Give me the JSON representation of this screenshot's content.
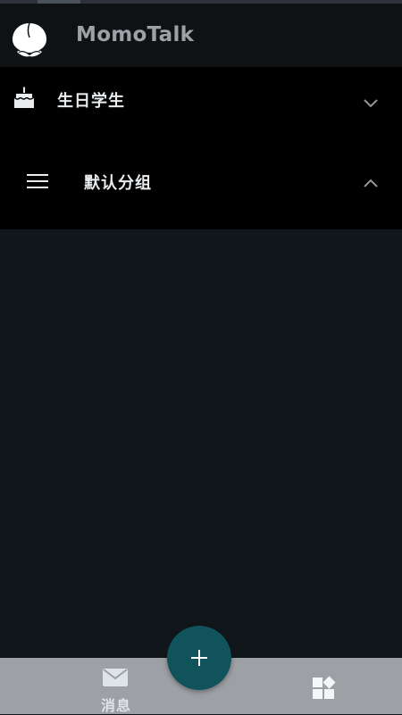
{
  "app": {
    "title": "MomoTalk",
    "logo_icon": "peach-icon"
  },
  "groups": [
    {
      "label": "生日学生",
      "icon": "cake-icon",
      "state_icon": "chevron-down-icon"
    },
    {
      "label": "默认分组",
      "icon": "menu-icon",
      "state_icon": "chevron-up-icon"
    }
  ],
  "fab": {
    "icon": "plus-icon",
    "color": "#10535a"
  },
  "bottom_nav": {
    "messages_label": "消息",
    "messages_icon": "mail-icon",
    "apps_icon": "apps-icon",
    "bar_color": "#9da0a4"
  },
  "colors": {
    "background": "#10161a",
    "panel": "#000000",
    "header": "#0f1215"
  }
}
